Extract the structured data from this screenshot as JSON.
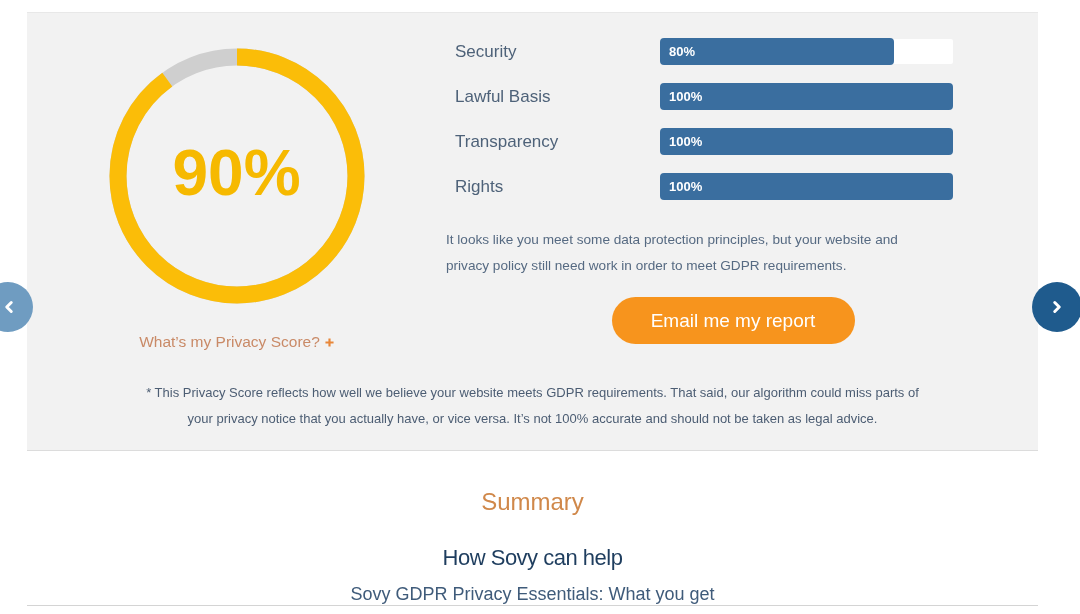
{
  "score": {
    "value": "90%",
    "level": 0.9,
    "help_link": "What’s my Privacy Score?"
  },
  "categories": [
    {
      "label": "Security",
      "level": 0.8,
      "reading": "80%"
    },
    {
      "label": "Lawful Basis",
      "level": 1,
      "reading": "100%"
    },
    {
      "label": "Transparency",
      "level": 1,
      "reading": "100%"
    },
    {
      "label": "Rights",
      "level": 1,
      "reading": "100%"
    }
  ],
  "message": "It looks like you meet some data protection principles, but your website and privacy policy still need work in order to meet GDPR requirements.",
  "button": "Email me my report",
  "footnote": "* This Privacy Score reflects how well we believe your website meets GDPR requirements. That said, our algorithm could miss parts of your privacy notice that you actually have, or vice versa. It’s not 100% accurate and should not be taken as legal advice.",
  "summary": {
    "title": "Summary",
    "heading": "How Sovy can help",
    "subheading": "Sovy GDPR Privacy Essentials: What you get"
  }
}
